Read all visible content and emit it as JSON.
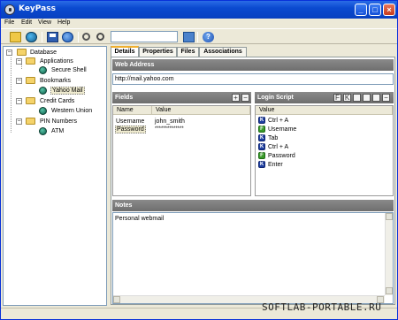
{
  "window": {
    "title": "KeyPass",
    "min": "_",
    "max": "□",
    "close": "×"
  },
  "menu": [
    "File",
    "Edit",
    "View",
    "Help"
  ],
  "toolbar": {
    "search_value": "",
    "help_glyph": "?"
  },
  "tree": {
    "root": "Database",
    "groups": [
      {
        "label": "Applications",
        "items": [
          "Secure Shell"
        ]
      },
      {
        "label": "Bookmarks",
        "items": [
          "Yahoo Mail"
        ]
      },
      {
        "label": "Credit Cards",
        "items": [
          "Western Union"
        ]
      },
      {
        "label": "PIN Numbers",
        "items": [
          "ATM"
        ]
      }
    ],
    "expander": "−"
  },
  "tabs": [
    "Details",
    "Properties",
    "Files",
    "Associations"
  ],
  "web_address": {
    "header": "Web Address",
    "value": "http://mail.yahoo.com"
  },
  "fields": {
    "header": "Fields",
    "col_name": "Name",
    "col_value": "Value",
    "rows": [
      {
        "name": "Username",
        "value": "john_smith"
      },
      {
        "name": "Password",
        "value": "**************"
      }
    ],
    "add": "+",
    "remove": "−"
  },
  "login_script": {
    "header": "Login Script",
    "col_value": "Value",
    "steps": [
      {
        "type": "K",
        "text": "Ctrl + A"
      },
      {
        "type": "F",
        "text": "Username"
      },
      {
        "type": "K",
        "text": "Tab"
      },
      {
        "type": "K",
        "text": "Ctrl + A"
      },
      {
        "type": "F",
        "text": "Password"
      },
      {
        "type": "K",
        "text": "Enter"
      }
    ],
    "buttons": [
      "F",
      "K",
      "",
      "",
      "",
      "−"
    ]
  },
  "notes": {
    "header": "Notes",
    "value": "Personal webmail"
  },
  "watermark": "SOFTLAB-PORTABLE.RU",
  "colors": {
    "title_bar": "#0a4ad0",
    "section_header": "#7a7a7a",
    "window_bg": "#ece9d8"
  }
}
